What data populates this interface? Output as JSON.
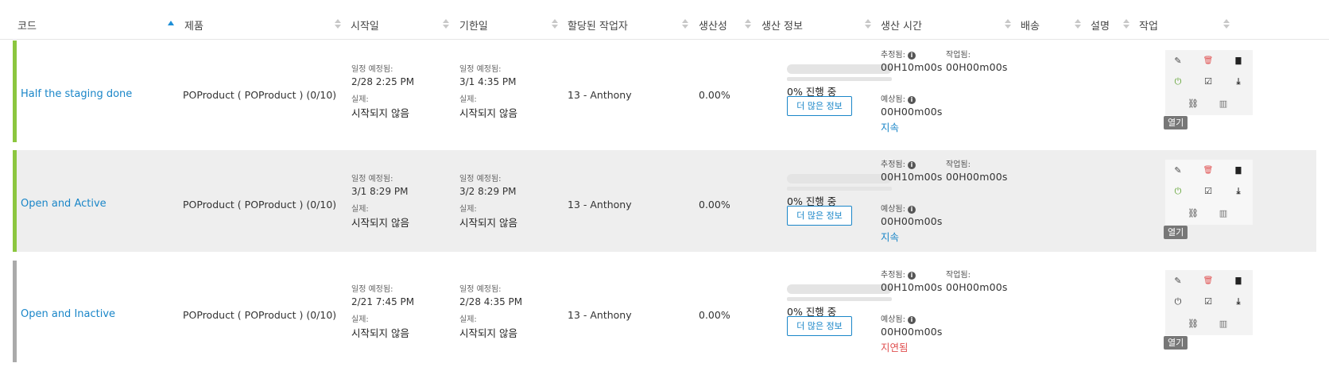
{
  "columns": {
    "code": "코드",
    "product": "제품",
    "start": "시작일",
    "due": "기한일",
    "worker": "할당된 작업자",
    "productivity": "생산성",
    "prod_info": "생산 정보",
    "prod_time": "생산 시간",
    "shipping": "배송",
    "description": "설명",
    "actions": "작업"
  },
  "labels": {
    "scheduled": "일정 예정됨:",
    "actual": "실제:",
    "estimated": "추정됨:",
    "worked": "작업됨:",
    "expected": "예상됨:",
    "more_info": "더 많은 정보",
    "open": "열기",
    "info_glyph": "i"
  },
  "icons": {
    "edit": "✎",
    "delete": "🗑",
    "file": "▇",
    "power": "⏻",
    "check": "☑",
    "download": "⤓",
    "hierarchy": "⛓",
    "barcode": "▥"
  },
  "rows": [
    {
      "code": "Half the staging done",
      "product": "POProduct ( POProduct ) (0/10)",
      "start_sched": "2/28  2:25 PM",
      "start_actual": "시작되지 않음",
      "due_sched": "3/1  4:35 PM",
      "due_actual": "시작되지 않음",
      "worker": "13 - Anthony",
      "productivity": "0.00%",
      "progress_pct": 0,
      "progress_text": "0% 진행 중",
      "estimated": "00H10m00s",
      "worked": "00H00m00s",
      "expected": "00H00m00s",
      "time_status": "지속",
      "time_status_color": "#1a86c8",
      "row_color": "#8cc63f"
    },
    {
      "code": "Open and Active",
      "product": "POProduct ( POProduct ) (0/10)",
      "start_sched": "3/1  8:29 PM",
      "start_actual": "시작되지 않음",
      "due_sched": "3/2  8:29 PM",
      "due_actual": "시작되지 않음",
      "worker": "13 - Anthony",
      "productivity": "0.00%",
      "progress_pct": 0,
      "progress_text": "0% 진행 중",
      "estimated": "00H10m00s",
      "worked": "00H00m00s",
      "expected": "00H00m00s",
      "time_status": "지속",
      "time_status_color": "#1a86c8",
      "row_color": "#8cc63f"
    },
    {
      "code": "Open and Inactive",
      "product": "POProduct ( POProduct ) (0/10)",
      "start_sched": "2/21  7:45 PM",
      "start_actual": "시작되지 않음",
      "due_sched": "2/28  4:35 PM",
      "due_actual": "시작되지 않음",
      "worker": "13 - Anthony",
      "productivity": "0.00%",
      "progress_pct": 0,
      "progress_text": "0% 진행 중",
      "estimated": "00H10m00s",
      "worked": "00H00m00s",
      "expected": "00H00m00s",
      "time_status": "지연됨",
      "time_status_color": "#e05050",
      "row_color": "#aaaaaa"
    }
  ]
}
